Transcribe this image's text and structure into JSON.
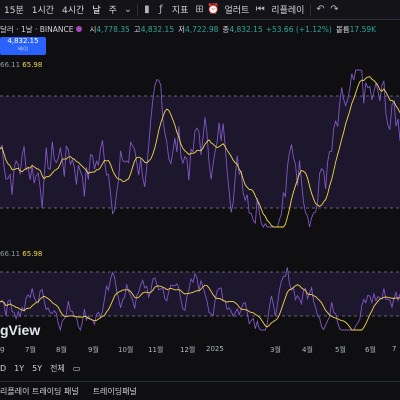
{
  "toolbar": {
    "items": [
      "15분",
      "1시간",
      "4시간",
      "날",
      "주"
    ],
    "active_index": 3,
    "indicator_label": "지표",
    "alert_label": "얼러트",
    "replay_label": "리플레이"
  },
  "symbol": {
    "name": "달러 · 1날 · BINANCE",
    "open_label": "시",
    "open": "4,778.35",
    "high_label": "고",
    "high": "4,832.15",
    "low_label": "저",
    "low": "4,722.98",
    "close_label": "종",
    "close": "4,832.15",
    "change": "+53.66 (+1.12%)",
    "volume_label": "볼륨",
    "volume": "17.59K"
  },
  "price_badge": {
    "price": "4,832.15",
    "sub": "바이"
  },
  "indicator1": {
    "a": "66.11",
    "b": "65.98"
  },
  "indicator2": {
    "a": "66.11",
    "b": "65.98"
  },
  "watermark": "gView",
  "time_axis": [
    "g",
    "7월",
    "8월",
    "9월",
    "10월",
    "11월",
    "12월",
    "2025",
    "3월",
    "4월",
    "5월",
    "6월",
    "7"
  ],
  "ranges": [
    "D",
    "1Y",
    "5Y",
    "전체"
  ],
  "bottom": [
    "리플레이 트레이딩 패널",
    "트레이딩패널"
  ],
  "colors": {
    "rsi_line": "#7e57c2",
    "ma_line": "#f5d547",
    "band_fill": "#2a1f44",
    "band_line": "#787b86",
    "accent": "#2962ff"
  }
}
